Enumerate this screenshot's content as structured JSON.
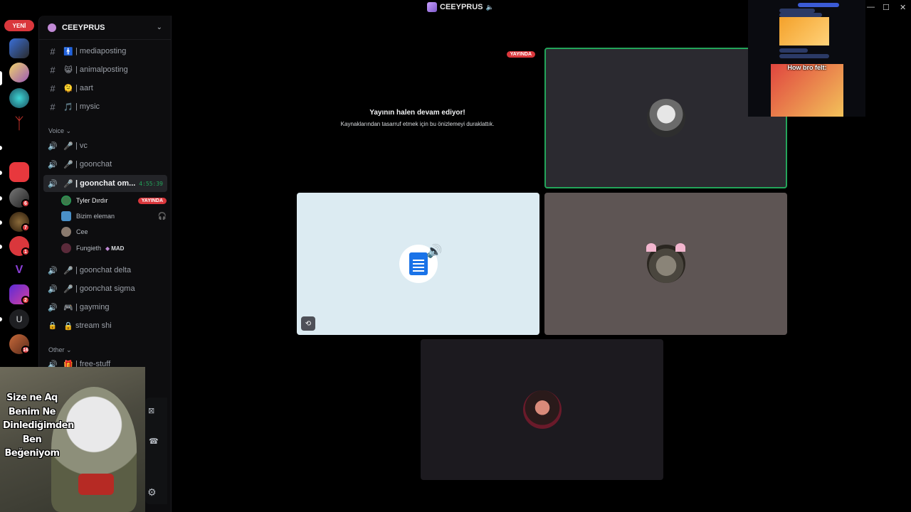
{
  "window": {
    "title": "CEEYPRUS",
    "controls": [
      "—",
      "☐",
      "✕"
    ]
  },
  "rail": {
    "new_badge": "YENİ",
    "badges": [
      "6",
      "7",
      "1",
      "2",
      "16"
    ],
    "user_letter": "U"
  },
  "server": {
    "name": "CEEYPRUS",
    "chevron": "⌄"
  },
  "text_channels": [
    {
      "emoji": "🚹",
      "name": "| mediaposting"
    },
    {
      "emoji": "😸",
      "name": "| animalposting"
    },
    {
      "emoji": "🫠",
      "name": "| aart"
    },
    {
      "emoji": "🎵",
      "name": "| mysic"
    }
  ],
  "categories": {
    "voice": "Voice ⌄",
    "other": "Other ⌄"
  },
  "voice_channels": [
    {
      "emoji": "🎤",
      "name": "| vc"
    },
    {
      "emoji": "🎤",
      "name": "| goonchat"
    },
    {
      "emoji": "🎤",
      "name": "| goonchat om...",
      "timer": "4:55:39",
      "active": true
    }
  ],
  "voice_members": [
    {
      "name": "Tyler Dırdır",
      "badge": "YAYINDA",
      "avatar_color": "#3c7a4a"
    },
    {
      "name": "Bizim eleman",
      "avatar_color": "#4a90c8"
    },
    {
      "name": "Cee",
      "avatar_color": "#8a7a6e"
    },
    {
      "name": "Fungieth",
      "tag": "MAD",
      "avatar_color": "#5a2a3a"
    }
  ],
  "voice_channels_2": [
    {
      "emoji": "🎤",
      "name": "| goonchat delta"
    },
    {
      "emoji": "🎤",
      "name": "| goonchat sigma"
    },
    {
      "emoji": "🎮",
      "name": "| gayming"
    },
    {
      "emoji": "🔒",
      "name": "stream shi",
      "locked": true
    }
  ],
  "other_channels": [
    {
      "emoji": "🎁",
      "name": "| free-stuff"
    }
  ],
  "stage": {
    "paused_title": "Yayının halen devam ediyor!",
    "paused_subtitle": "Kaynaklarından tasarruf etmek için bu önizlemeyi duraklattık.",
    "live_tag": "YAYINDA"
  },
  "preview": {
    "caption": "How bro felt:"
  },
  "meme": {
    "text": "Size ne Aq Benim Ne Dinlediğimden Ben Beğeniyom"
  },
  "colors": {
    "live_red": "#da373c",
    "speaking_green": "#23a55a",
    "tile_dark": "#2b2a30",
    "tile_light": "#dcebf2",
    "tile_taupe": "#5e5554"
  }
}
